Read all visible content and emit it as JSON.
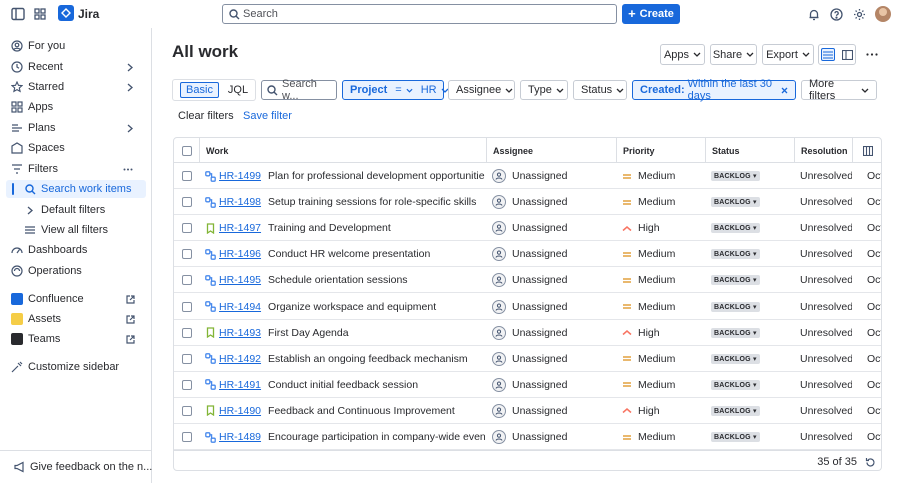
{
  "app": {
    "name": "Jira"
  },
  "topbar": {
    "search_placeholder": "Search",
    "create_label": "Create"
  },
  "sidebar": {
    "items": [
      {
        "label": "For you",
        "icon": "user-circle-icon"
      },
      {
        "label": "Recent",
        "icon": "clock-icon"
      },
      {
        "label": "Starred",
        "icon": "star-icon"
      },
      {
        "label": "Apps",
        "icon": "apps-icon"
      },
      {
        "label": "Plans",
        "icon": "plans-icon"
      },
      {
        "label": "Spaces",
        "icon": "spaces-icon"
      },
      {
        "label": "Filters",
        "icon": "filter-icon"
      },
      {
        "label": "Search work items",
        "icon": "search-icon"
      },
      {
        "label": "Default filters",
        "icon": "chevron-right-icon"
      },
      {
        "label": "View all filters",
        "icon": "list-icon"
      },
      {
        "label": "Dashboards",
        "icon": "dashboard-icon"
      },
      {
        "label": "Operations",
        "icon": "operations-icon"
      }
    ],
    "apps": [
      {
        "label": "Confluence",
        "color": "#1868db"
      },
      {
        "label": "Assets",
        "color": "#f5cd47"
      },
      {
        "label": "Teams",
        "color": "#292a2e"
      }
    ],
    "customize_label": "Customize sidebar",
    "feedback_label": "Give feedback on the n..."
  },
  "main": {
    "title": "All work",
    "header_buttons": {
      "apps": "Apps",
      "share": "Share",
      "export": "Export"
    },
    "mode": {
      "basic": "Basic",
      "jql": "JQL"
    },
    "filters": {
      "search_placeholder": "Search w...",
      "project_label": "Project",
      "project_operator": "=",
      "project_value": "HR",
      "assignee": "Assignee",
      "type": "Type",
      "status": "Status",
      "created_label": "Created:",
      "created_value": "Within the last 30 days",
      "more": "More filters"
    },
    "clear_filters": "Clear filters",
    "save_filter": "Save filter",
    "columns": {
      "work": "Work",
      "assignee": "Assignee",
      "priority": "Priority",
      "status": "Status",
      "resolution": "Resolution"
    },
    "rows": [
      {
        "key": "HR-1499",
        "summary": "Plan for professional development opportunities",
        "type": "subtask",
        "assignee": "Unassigned",
        "priority": "Medium",
        "status": "BACKLOG",
        "resolution": "Unresolved",
        "created": "Oct"
      },
      {
        "key": "HR-1498",
        "summary": "Setup training sessions for role-specific skills",
        "type": "subtask",
        "assignee": "Unassigned",
        "priority": "Medium",
        "status": "BACKLOG",
        "resolution": "Unresolved",
        "created": "Oct"
      },
      {
        "key": "HR-1497",
        "summary": "Training and Development",
        "type": "story",
        "assignee": "Unassigned",
        "priority": "High",
        "status": "BACKLOG",
        "resolution": "Unresolved",
        "created": "Oct"
      },
      {
        "key": "HR-1496",
        "summary": "Conduct HR welcome presentation",
        "type": "subtask",
        "assignee": "Unassigned",
        "priority": "Medium",
        "status": "BACKLOG",
        "resolution": "Unresolved",
        "created": "Oct"
      },
      {
        "key": "HR-1495",
        "summary": "Schedule orientation sessions",
        "type": "subtask",
        "assignee": "Unassigned",
        "priority": "Medium",
        "status": "BACKLOG",
        "resolution": "Unresolved",
        "created": "Oct"
      },
      {
        "key": "HR-1494",
        "summary": "Organize workspace and equipment",
        "type": "subtask",
        "assignee": "Unassigned",
        "priority": "Medium",
        "status": "BACKLOG",
        "resolution": "Unresolved",
        "created": "Oct"
      },
      {
        "key": "HR-1493",
        "summary": "First Day Agenda",
        "type": "story",
        "assignee": "Unassigned",
        "priority": "High",
        "status": "BACKLOG",
        "resolution": "Unresolved",
        "created": "Oct"
      },
      {
        "key": "HR-1492",
        "summary": "Establish an ongoing feedback mechanism",
        "type": "subtask",
        "assignee": "Unassigned",
        "priority": "Medium",
        "status": "BACKLOG",
        "resolution": "Unresolved",
        "created": "Oct"
      },
      {
        "key": "HR-1491",
        "summary": "Conduct initial feedback session",
        "type": "subtask",
        "assignee": "Unassigned",
        "priority": "Medium",
        "status": "BACKLOG",
        "resolution": "Unresolved",
        "created": "Oct"
      },
      {
        "key": "HR-1490",
        "summary": "Feedback and Continuous Improvement",
        "type": "story",
        "assignee": "Unassigned",
        "priority": "High",
        "status": "BACKLOG",
        "resolution": "Unresolved",
        "created": "Oct"
      },
      {
        "key": "HR-1489",
        "summary": "Encourage participation in company-wide events",
        "type": "subtask",
        "assignee": "Unassigned",
        "priority": "Medium",
        "status": "BACKLOG",
        "resolution": "Unresolved",
        "created": "Oct"
      }
    ],
    "count_label": "35 of 35"
  },
  "colors": {
    "accent": "#1868db",
    "medium": "#e2a03f",
    "high": "#f87462",
    "story": "#82b536",
    "subtask": "#4688ec"
  }
}
